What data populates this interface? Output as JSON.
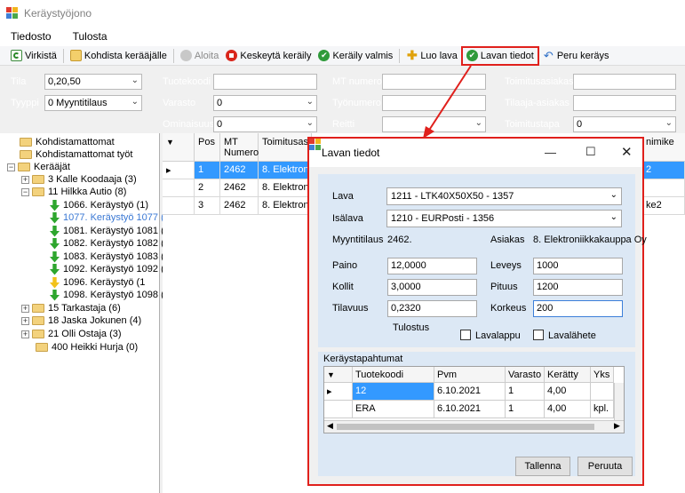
{
  "window": {
    "title": "Keräystyöjono"
  },
  "menu": {
    "items": [
      "Tiedosto",
      "Tulosta"
    ]
  },
  "toolbar": {
    "refresh": "Virkistä",
    "assign": "Kohdista kerääjälle",
    "start": "Aloita",
    "suspend": "Keskeytä keräily",
    "done": "Keräily valmis",
    "create_pallet": "Luo lava",
    "pallet_info": "Lavan tiedot",
    "cancel": "Peru keräys"
  },
  "filters": {
    "tila_label": "Tila",
    "tila_value": "0,20,50",
    "tyyppi_label": "Tyyppi",
    "tyyppi_value": "0 Myyntitilaus",
    "tuotekoodi_label": "Tuotekoodi",
    "varasto_label": "Varasto",
    "varasto_value": "0",
    "ominaisuus_label": "Ominaisuus",
    "ominaisuus_value": "0",
    "mtnumero_label": "MT numero",
    "tyonumero_label": "Työnumero",
    "reitti_label": "Reitti",
    "toimitusasiakas_label": "Toimitusasiakas",
    "tilaaja_label": "Tilaaja-asiakas",
    "toimitustapa_label": "Toimitustapa",
    "toimitustapa_value": "0"
  },
  "tree": {
    "n1": "Kohdistamattomat",
    "n2": "Kohdistamattomat työt",
    "n3": "Kerääjät",
    "n4": "3 Kalle Koodaaja (3)",
    "n5": "11 Hilkka Autio (8)",
    "n6": "1066. Keräystyö (1)",
    "n7": "1077. Keräystyö 1077 (3",
    "n8": "1081. Keräystyö 1081 (1",
    "n9": "1082. Keräystyö 1082 (1",
    "n10": "1083. Keräystyö 1083 (1",
    "n11": "1092. Keräystyö 1092 (1",
    "n12": "1096. Keräystyö (1",
    "n13": "1098. Keräystyö 1098 (1",
    "n14": "15 Tarkastaja (6)",
    "n15": "18 Jaska Jokunen (4)",
    "n16": "21 Olli Ostaja (3)",
    "n17": "400 Heikki Hurja (0)"
  },
  "grid": {
    "headers": {
      "pos": "Pos",
      "mt": "MT Numero",
      "toim": "Toimitusasia",
      "nimike": "nimike"
    },
    "rows": [
      {
        "pos": "1",
        "mt": "2462",
        "toim": "8. Elektroniik",
        "nimike": "2"
      },
      {
        "pos": "2",
        "mt": "2462",
        "toim": "8. Elektroniik",
        "nimike": ""
      },
      {
        "pos": "3",
        "mt": "2462",
        "toim": "8. Elektroniik",
        "nimike": "ke2"
      }
    ]
  },
  "dialog": {
    "title": "Lavan tiedot",
    "lava_label": "Lava",
    "lava_value": "1211 - LTK40X50X50 - 1357",
    "isalava_label": "Isälava",
    "isalava_value": "1210 - EURPosti - 1356",
    "myyntitilaus_label": "Myyntitilaus",
    "myyntitilaus_value": "2462.",
    "asiakas_label": "Asiakas",
    "asiakas_value": "8. Elektroniikkakauppa Oy",
    "paino_label": "Paino",
    "paino_value": "12,0000",
    "kollit_label": "Kollit",
    "kollit_value": "3,0000",
    "tilavuus_label": "Tilavuus",
    "tilavuus_value": "0,2320",
    "leveys_label": "Leveys",
    "leveys_value": "1000",
    "pituus_label": "Pituus",
    "pituus_value": "1200",
    "korkeus_label": "Korkeus",
    "korkeus_value": "200",
    "tulostus_label": "Tulostus",
    "lavalappu_label": "Lavalappu",
    "lavalahete_label": "Lavalähete",
    "events_label": "Keräystapahtumat",
    "events_headers": {
      "tuotekoodi": "Tuotekoodi",
      "pvm": "Pvm",
      "varasto": "Varasto",
      "keratty": "Kerätty",
      "yks": "Yks"
    },
    "events_rows": [
      {
        "tuotekoodi": "12",
        "pvm": "6.10.2021",
        "varasto": "1",
        "keratty": "4,00",
        "yks": ""
      },
      {
        "tuotekoodi": "ERA",
        "pvm": "6.10.2021",
        "varasto": "1",
        "keratty": "4,00",
        "yks": "kpl."
      }
    ],
    "save": "Tallenna",
    "cancel": "Peruuta"
  }
}
